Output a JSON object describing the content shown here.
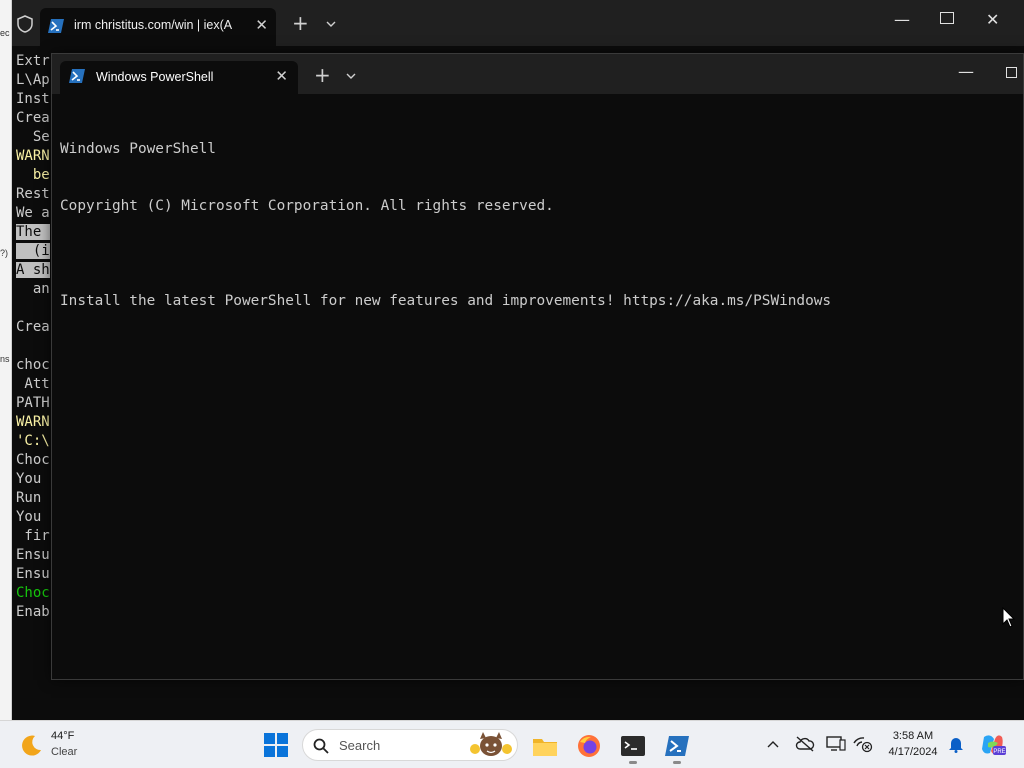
{
  "background_app": {
    "edge_chars": [
      "ec",
      "?)",
      "ns"
    ]
  },
  "back_window": {
    "tab_title": "irm christitus.com/win | iex(A",
    "lines": [
      {
        "text": "Extr",
        "style": "normal"
      },
      {
        "text": "L\\Ap",
        "style": "normal"
      },
      {
        "text": "Inst",
        "style": "normal"
      },
      {
        "text": "Crea",
        "style": "normal"
      },
      {
        "text": "  Se",
        "style": "normal"
      },
      {
        "text": "WARN",
        "style": "warn"
      },
      {
        "text": "  be",
        "style": "warn"
      },
      {
        "text": "Rest",
        "style": "normal"
      },
      {
        "text": "We a",
        "style": "normal"
      },
      {
        "text": "The ",
        "style": "sel"
      },
      {
        "text": "  (i",
        "style": "sel"
      },
      {
        "text": "A sh",
        "style": "sel"
      },
      {
        "text": "  an",
        "style": "normal"
      },
      {
        "text": "",
        "style": "normal"
      },
      {
        "text": "Crea",
        "style": "normal"
      },
      {
        "text": "",
        "style": "normal"
      },
      {
        "text": "choc",
        "style": "normal"
      },
      {
        "text": " Att",
        "style": "normal"
      },
      {
        "text": "PATH",
        "style": "normal"
      },
      {
        "text": "WARN",
        "style": "warn"
      },
      {
        "text": "'C:\\",
        "style": "warn"
      },
      {
        "text": "Choc",
        "style": "normal"
      },
      {
        "text": "You ",
        "style": "normal"
      },
      {
        "text": "Run ",
        "style": "normal"
      },
      {
        "text": "You ",
        "style": "normal"
      },
      {
        "text": " fir",
        "style": "normal"
      },
      {
        "text": "Ensu",
        "style": "normal"
      },
      {
        "text": "Ensu",
        "style": "normal"
      },
      {
        "text": "Choc",
        "style": "green"
      },
      {
        "text": "Enab",
        "style": "normal"
      }
    ]
  },
  "front_window": {
    "tab_title": "Windows PowerShell",
    "lines": [
      "Windows PowerShell",
      "Copyright (C) Microsoft Corporation. All rights reserved.",
      "",
      "Install the latest PowerShell for new features and improvements! https://aka.ms/PSWindows"
    ]
  },
  "taskbar": {
    "weather": {
      "temp": "44°F",
      "condition": "Clear",
      "icon": "moon-icon"
    },
    "search_label": "Search",
    "clock": {
      "time": "3:58 AM",
      "date": "4/17/2024"
    }
  },
  "colors": {
    "terminal_bg": "#0c0c0c",
    "terminal_fg": "#cccccc",
    "warn": "#f9f1a5",
    "success": "#16c60c",
    "tab_bar": "#202020",
    "taskbar_bg": "#eef0f4"
  }
}
